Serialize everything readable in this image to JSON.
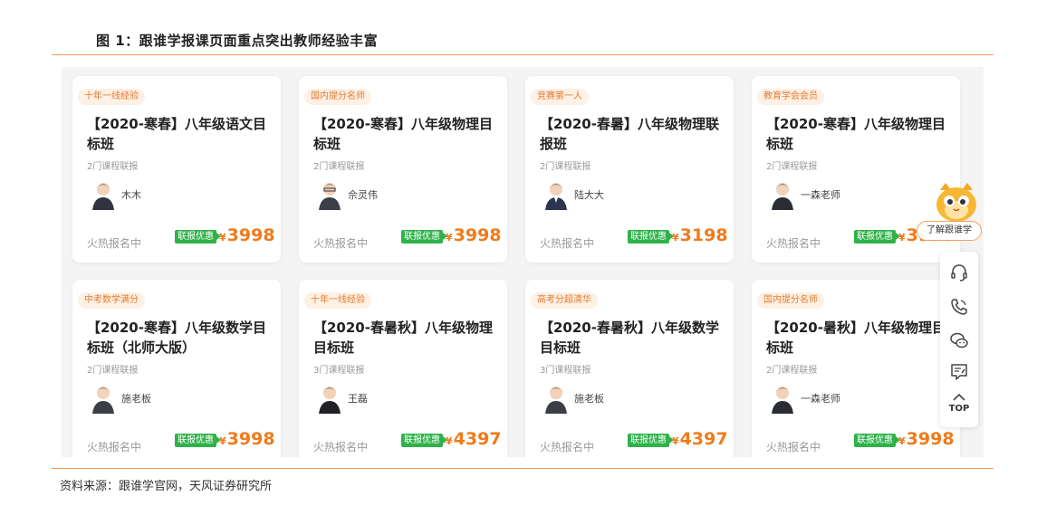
{
  "figure": {
    "title": "图 1：跟谁学报课页面重点突出教师经验丰富",
    "source": "资料来源：跟谁学官网，天风证券研究所"
  },
  "common": {
    "status": "火热报名中",
    "badge": "联报优惠",
    "currency": "¥"
  },
  "cards": [
    {
      "tag": "十年一线经验",
      "title": "【2020-寒春】八年级语文目标班",
      "subtitle": "2门课程联报",
      "teacher": "木木",
      "price": "3998"
    },
    {
      "tag": "国内提分名师",
      "title": "【2020-寒春】八年级物理目标班",
      "subtitle": "2门课程联报",
      "teacher": "佘灵伟",
      "price": "3998"
    },
    {
      "tag": "竞赛第一人",
      "title": "【2020-春暑】八年级物理联报班",
      "subtitle": "2门课程联报",
      "teacher": "陆大大",
      "price": "3198"
    },
    {
      "tag": "教育学会会员",
      "title": "【2020-寒春】八年级物理目标班",
      "subtitle": "2门课程联报",
      "teacher": "一森老师",
      "price": "3998"
    },
    {
      "tag": "中考数学满分",
      "title": "【2020-寒春】八年级数学目标班（北师大版）",
      "subtitle": "2门课程联报",
      "teacher": "施老板",
      "price": "3998"
    },
    {
      "tag": "十年一线经验",
      "title": "【2020-春暑秋】八年级物理目标班",
      "subtitle": "3门课程联报",
      "teacher": "王磊",
      "price": "4397"
    },
    {
      "tag": "高考分超清华",
      "title": "【2020-春暑秋】八年级数学目标班",
      "subtitle": "3门课程联报",
      "teacher": "施老板",
      "price": "4397"
    },
    {
      "tag": "国内提分名师",
      "title": "【2020-暑秋】八年级物理目标班",
      "subtitle": "2门课程联报",
      "teacher": "一森老师",
      "price": "3998"
    }
  ],
  "sidebar": {
    "bubble": "了解跟谁学",
    "top_label": "TOP",
    "icons": [
      "headset-icon",
      "phone-icon",
      "wechat-icon",
      "feedback-icon",
      "chevron-up-icon"
    ]
  },
  "colors": {
    "accent": "#f07a1c",
    "badge_green": "#2fb24a",
    "rule": "#f0a060"
  }
}
